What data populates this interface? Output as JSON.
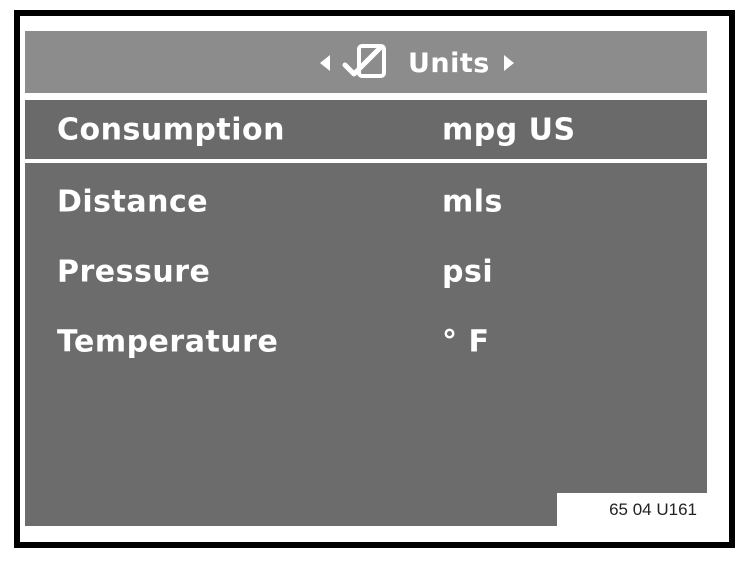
{
  "header": {
    "title": "Units",
    "left_icon": "left-arrow-icon",
    "right_icon": "right-arrow-icon",
    "units_icon": "checkbox-icon"
  },
  "rows": [
    {
      "label": "Consumption",
      "value": "mpg US",
      "selected": true
    },
    {
      "label": "Distance",
      "value": "mls",
      "selected": false
    },
    {
      "label": "Pressure",
      "value": "psi",
      "selected": false
    },
    {
      "label": "Temperature",
      "value": "° F",
      "selected": false
    }
  ],
  "footer": {
    "code": "65 04 U161"
  },
  "colors": {
    "header_bg": "#8c8c8c",
    "screen_bg": "#6c6c6c",
    "text": "#ffffff"
  }
}
